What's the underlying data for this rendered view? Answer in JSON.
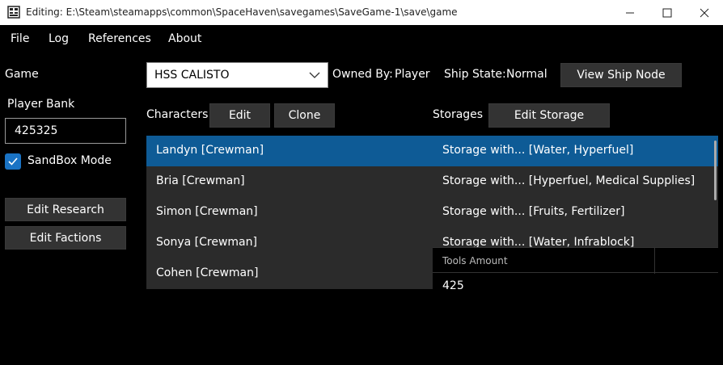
{
  "window": {
    "title": "Editing: E:\\Steam\\steamapps\\common\\SpaceHaven\\savegames\\SaveGame-1\\save\\game"
  },
  "menu": [
    "File",
    "Log",
    "References",
    "About"
  ],
  "left": {
    "game_label": "Game",
    "player_bank_label": "Player Bank",
    "player_bank_value": "425325",
    "sandbox_label": "SandBox Mode",
    "sandbox_checked": true,
    "edit_research": "Edit Research",
    "edit_factions": "Edit Factions"
  },
  "ship": {
    "selected": "HSS CALISTO",
    "owned_by_label": "Owned By:",
    "owned_by_value": "Player",
    "ship_state_label": "Ship State:",
    "ship_state_value": "Normal",
    "view_node_button": "View Ship Node"
  },
  "characters": {
    "label": "Characters",
    "edit_button": "Edit",
    "clone_button": "Clone",
    "items": [
      "Landyn [Crewman]",
      "Bria [Crewman]",
      "Simon [Crewman]",
      "Sonya [Crewman]",
      "Cohen [Crewman]"
    ],
    "selected_index": 0
  },
  "storages": {
    "label": "Storages",
    "edit_button": "Edit Storage",
    "items": [
      "Storage with... [Water, Hyperfuel]",
      "Storage with... [Hyperfuel, Medical Supplies]",
      "Storage with... [Fruits, Fertilizer]",
      "Storage with... [Water, Infrablock]"
    ],
    "selected_index": 0
  },
  "tools_grid": {
    "header": "Tools Amount",
    "value": "425"
  },
  "colors": {
    "selected_row": "#0e5b96",
    "list_bg": "#2b2b2b",
    "checkbox": "#1a73c4"
  }
}
